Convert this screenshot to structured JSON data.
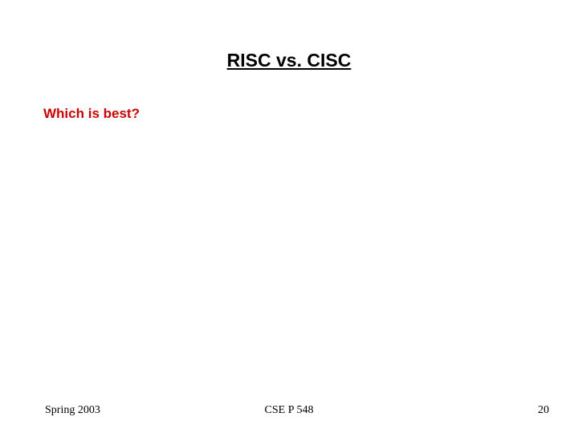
{
  "slide": {
    "title": "RISC vs. CISC",
    "body": "Which is best?"
  },
  "footer": {
    "left": "Spring 2003",
    "center": "CSE P 548",
    "right": "20"
  }
}
